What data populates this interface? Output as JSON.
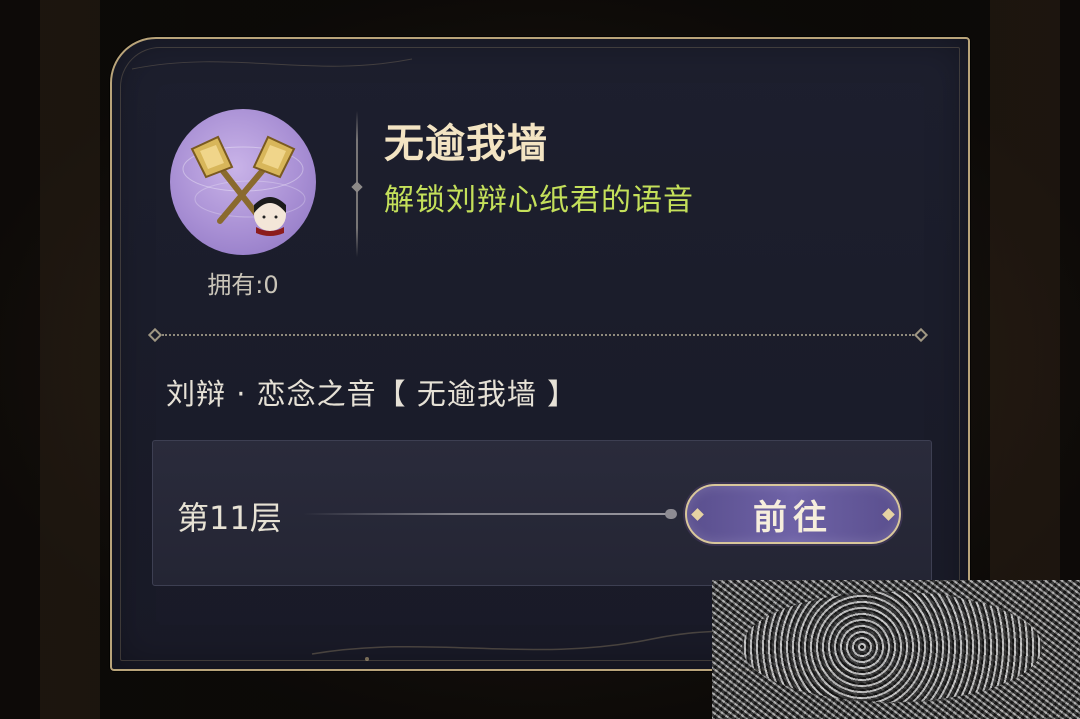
{
  "item": {
    "title": "无逾我墙",
    "description": "解锁刘辩心纸君的语音",
    "owned_prefix": "拥有:",
    "owned_count": "0",
    "icon": "crossed-golden-axes-with-chibi-icon"
  },
  "voice": {
    "label": "刘辩 · 恋念之音【 无逾我墙 】"
  },
  "task": {
    "floor_label": "第11层",
    "go_button_label": "前往"
  },
  "colors": {
    "panel_border": "#b9a47a",
    "title": "#f3e4c3",
    "description": "#c4e05a",
    "icon_bg": "#a88fd4",
    "button_bg": "#6e62a6"
  }
}
